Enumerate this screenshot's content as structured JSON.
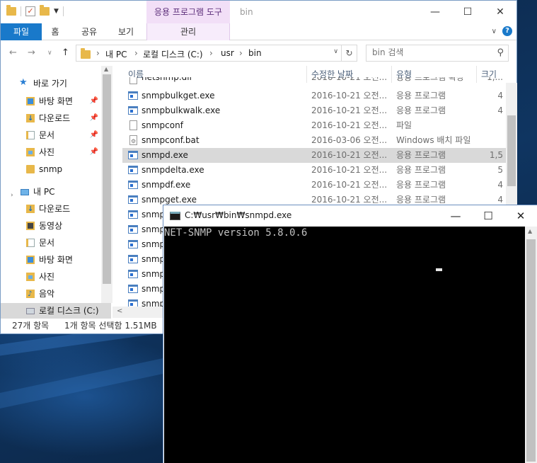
{
  "explorer": {
    "title": "bin",
    "context_tab_group": "응용 프로그램 도구",
    "tabs": {
      "file": "파일",
      "home": "홈",
      "share": "공유",
      "view": "보기",
      "manage": "관리"
    },
    "address": {
      "pc": "내 PC",
      "drive": "로컬 디스크 (C:)",
      "usr": "usr",
      "bin": "bin"
    },
    "search_placeholder": "bin 검색",
    "nav": {
      "quick_access": "바로 가기",
      "desktop": "바탕 화면",
      "downloads": "다운로드",
      "documents": "문서",
      "pictures": "사진",
      "snmp": "snmp",
      "this_pc": "내 PC",
      "pc_downloads": "다운로드",
      "pc_videos": "동영상",
      "pc_documents": "문서",
      "pc_desktop": "바탕 화면",
      "pc_pictures": "사진",
      "pc_music": "음악",
      "pc_local_disk": "로컬 디스크 (C:)"
    },
    "columns": {
      "name": "이름",
      "date": "수정한 날짜",
      "type": "유형",
      "size": "크기"
    },
    "rows": [
      {
        "name": "netsnmp.dll",
        "date": "2016-10-21 오전...",
        "type": "응용 프로그램 확장",
        "size": "1,..."
      },
      {
        "name": "snmpbulkget.exe",
        "date": "2016-10-21 오전...",
        "type": "응용 프로그램",
        "size": "4"
      },
      {
        "name": "snmpbulkwalk.exe",
        "date": "2016-10-21 오전...",
        "type": "응용 프로그램",
        "size": "4"
      },
      {
        "name": "snmpconf",
        "date": "2016-10-21 오전...",
        "type": "파일",
        "size": ""
      },
      {
        "name": "snmpconf.bat",
        "date": "2016-03-06 오전...",
        "type": "Windows 배치 파일",
        "size": ""
      },
      {
        "name": "snmpd.exe",
        "date": "2016-10-21 오전...",
        "type": "응용 프로그램",
        "size": "1,5"
      },
      {
        "name": "snmpdelta.exe",
        "date": "2016-10-21 오전...",
        "type": "응용 프로그램",
        "size": "5"
      },
      {
        "name": "snmpdf.exe",
        "date": "2016-10-21 오전...",
        "type": "응용 프로그램",
        "size": "4"
      },
      {
        "name": "snmpget.exe",
        "date": "2016-10-21 오전...",
        "type": "응용 프로그램",
        "size": "4"
      },
      {
        "name": "snmpgetnext.exe",
        "date": "",
        "type": "",
        "size": ""
      },
      {
        "name": "snmpnetstat.exe",
        "date": "",
        "type": "",
        "size": ""
      },
      {
        "name": "snmpset.exe",
        "date": "",
        "type": "",
        "size": ""
      },
      {
        "name": "snmpstatus.exe",
        "date": "",
        "type": "",
        "size": ""
      },
      {
        "name": "snmptable.exe",
        "date": "",
        "type": "",
        "size": ""
      },
      {
        "name": "snmptest.exe",
        "date": "",
        "type": "",
        "size": ""
      },
      {
        "name": "snmptranslate.exe",
        "date": "",
        "type": "",
        "size": ""
      }
    ],
    "status": {
      "count": "27개 항목",
      "selection": "1개 항목 선택함 1.51MB"
    }
  },
  "console": {
    "title": "C:₩usr₩bin₩snmpd.exe",
    "output": "NET-SNMP version 5.8.0.6"
  },
  "icons": {
    "minimize": "minimize-icon",
    "maximize": "maximize-icon",
    "close": "close-icon"
  },
  "colors": {
    "file_tab": "#1979ca",
    "context_tab": "#f2dff7",
    "selection": "#d9d9d9",
    "console_bg": "#000000"
  }
}
